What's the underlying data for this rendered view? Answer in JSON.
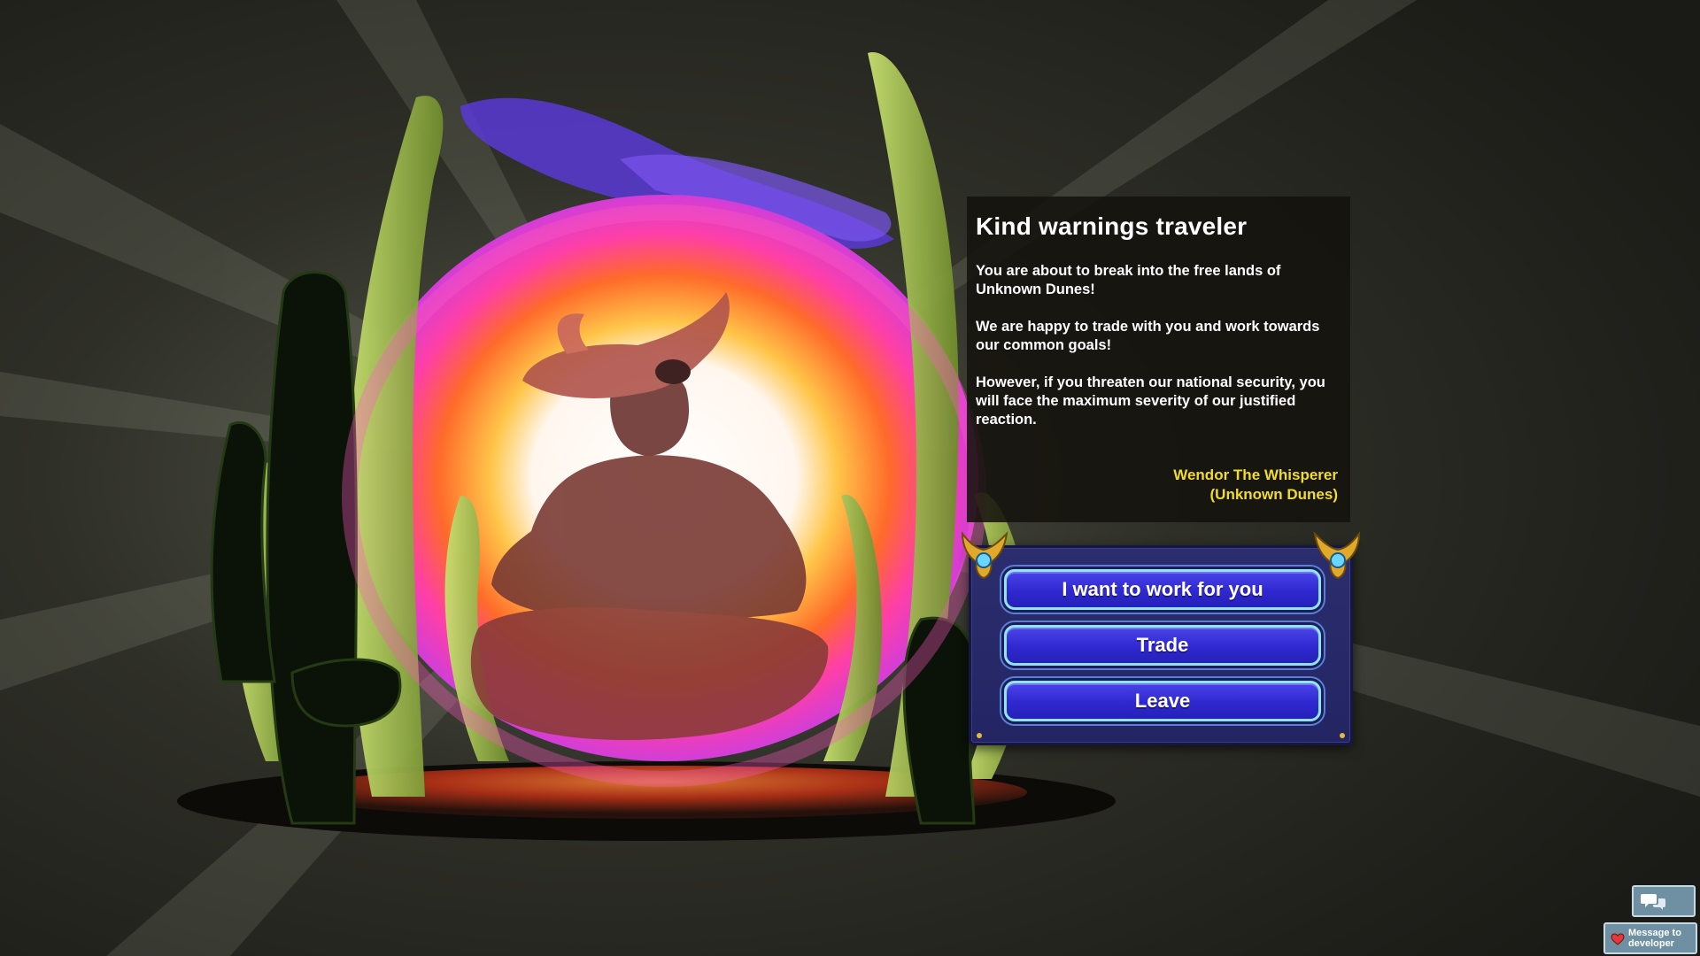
{
  "dialog": {
    "title": "Kind warnings traveler",
    "paragraphs": [
      "You are about to break into the free lands of Unknown Dunes!",
      "We are happy to trade with you and work towards our common goals!",
      "However, if you threaten our national security, you will face the maximum severity of our justified reaction."
    ],
    "speaker_name": "Wendor The Whisperer",
    "speaker_faction": "(Unknown Dunes)"
  },
  "choices": [
    {
      "label": "I want to work for you"
    },
    {
      "label": "Trade"
    },
    {
      "label": "Leave"
    }
  ],
  "widgets": {
    "chat_icon": "chat-bubbles-icon",
    "message_to_developer": "Message to developer",
    "heart_icon": "heart-icon"
  },
  "colors": {
    "speaker": "#f2dc2a",
    "button_fill": "#3530d8",
    "button_border": "#8fe3ff",
    "panel": "#2b2d6e"
  }
}
